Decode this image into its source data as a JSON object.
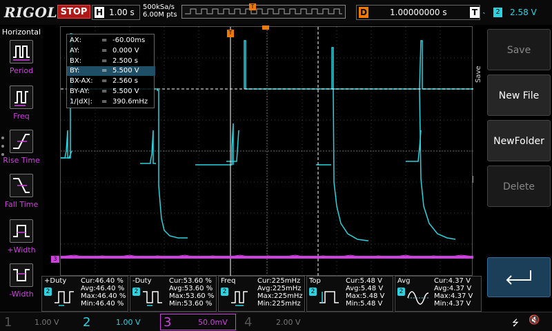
{
  "brand": "RIGOL",
  "status": "STOP",
  "horizontal": {
    "letter": "H",
    "timebase": "1.00 s",
    "sample_rate": "500kSa/s",
    "memory_depth": "6.00M pts"
  },
  "trigger_marker": "T",
  "delay": {
    "letter": "D",
    "value": "1.00000000 s"
  },
  "trigger": {
    "letter": "T",
    "source": "2",
    "level": "2.58 V"
  },
  "left_panel": {
    "title": "Horizontal",
    "items": [
      {
        "label": "Period",
        "icon": "period-icon"
      },
      {
        "label": "Freq",
        "icon": "freq-icon"
      },
      {
        "label": "Rise Time",
        "icon": "rise-time-icon"
      },
      {
        "label": "Fall Time",
        "icon": "fall-time-icon"
      },
      {
        "label": "+Width",
        "icon": "pos-width-icon"
      },
      {
        "label": "-Width",
        "icon": "neg-width-icon"
      }
    ]
  },
  "cursor": {
    "rows": [
      {
        "label": "AX:",
        "eq": "=",
        "value": "-60.00ms"
      },
      {
        "label": "AY:",
        "eq": "=",
        "value": "0.000 V"
      },
      {
        "label": "BX:",
        "eq": "=",
        "value": "2.500 s"
      },
      {
        "label": "BY:",
        "eq": "=",
        "value": "5.500 V"
      },
      {
        "label": "BX-AX:",
        "eq": "=",
        "value": "2.560 s"
      },
      {
        "label": "BY-AY:",
        "eq": "=",
        "value": "5.500 V"
      },
      {
        "label": "1/|dX|:",
        "eq": "=",
        "value": "390.6mHz"
      }
    ]
  },
  "markers": {
    "ch3": "3",
    "trig_level": "T"
  },
  "right_panel": {
    "tab": "Save",
    "buttons": [
      {
        "label": "Save",
        "disabled": true
      },
      {
        "label": "New File",
        "disabled": false
      },
      {
        "label": "NewFolder",
        "disabled": false
      },
      {
        "label": "Delete",
        "disabled": true
      }
    ]
  },
  "measurements": [
    {
      "name": "+Duty",
      "ch": "2",
      "cur": "Cur:46.40 %",
      "avg": "Avg:46.40 %",
      "max": "Max:46.40 %",
      "min": "Min:46.40 %"
    },
    {
      "name": "-Duty",
      "ch": "2",
      "cur": "Cur:53.60 %",
      "avg": "Avg:53.60 %",
      "max": "Max:53.60 %",
      "min": "Min:53.60 %"
    },
    {
      "name": "Freq",
      "ch": "2",
      "cur": "Cur:225mHz",
      "avg": "Avg:225mHz",
      "max": "Max:225mHz",
      "min": "Min:225mHz"
    },
    {
      "name": "Top",
      "ch": "2",
      "cur": "Cur:5.48 V",
      "avg": "Avg:5.48 V",
      "max": "Max:5.48 V",
      "min": "Min:5.48 V"
    },
    {
      "name": "Avg",
      "ch": "2",
      "cur": "Cur:4.37 V",
      "avg": "Avg:4.37 V",
      "max": "Max:4.37 V",
      "min": "Min:4.37 V"
    }
  ],
  "channels": [
    {
      "num": "1",
      "scale": "1.00 V",
      "color": "#c8c84a",
      "active": false
    },
    {
      "num": "2",
      "scale": "1.00 V",
      "color": "#2bd3e0",
      "active": false
    },
    {
      "num": "3",
      "scale": "50.0mV",
      "color": "#d040e0",
      "active": true
    },
    {
      "num": "4",
      "scale": "2.00 V",
      "color": "#4a6bff",
      "active": false
    }
  ],
  "colors": {
    "ch2": "#2bd3e0",
    "ch3": "#d040e0",
    "trigger": "#f07a00",
    "status_stop": "#b01818"
  }
}
